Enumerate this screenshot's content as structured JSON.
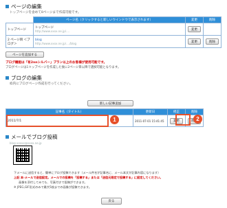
{
  "page_edit": {
    "title": "ページの編集",
    "subtitle": "トップページを含めて8ページまで作成可能です。",
    "header": "ページ名（クリックすると新しいウインドウで表示されます）",
    "edit_header": "変更",
    "delete_header": "削除",
    "rows": [
      {
        "label": "トップページ",
        "name": "トップページ",
        "url": "http://www.xxxx.ne.jp/....",
        "edit": "変更",
        "delete": ""
      },
      {
        "label": "2 ページ目 ＜ブログ＞",
        "name": "blog",
        "url": "http://www.xxxx.ne.jp/..../blog",
        "edit": "変更",
        "delete": "削除"
      }
    ],
    "add_button": "ページを追加する"
  },
  "notice": {
    "line1": "ブログ機能は「有2nnシルバー」プラン以上のお客様が使用可能です。",
    "line2": "ブログページは1トップページを作成した後に2ページ目以降で選択可能となります。"
  },
  "blog_edit": {
    "title": "ブログの編集",
    "subtitle": "枠内にブログページ作成を行ってください。",
    "new_button": "新しい記事追加",
    "headers": {
      "title": "記事名（タイトル）",
      "date": "更新日",
      "edit": "修正",
      "delete": "削除"
    },
    "rows": [
      {
        "title": "2011/7/1",
        "date": "2011-07-01 15:41:45",
        "edit": "変更",
        "delete": "削除"
      }
    ]
  },
  "callouts": {
    "one": "1",
    "two": "2"
  },
  "mail_blog": {
    "title": "メールでブログ投稿",
    "address": "blog-xxxxx@xxxx.ne.jp",
    "desc1": "下メールに送信すると、簡単にブログ投稿できます（メール件名が記事名に、メール本文が記事内容になります）",
    "desc2": "上記 本-メールで送信設定。メールでの投稿を「投稿する」または「送信元限定で投稿する」に設定してください。",
    "desc3": "画像を添付してみても、写真付きで投稿ができます。",
    "desc4": "※ JPEG,GIF形式のみで最大5枚までの画像が投稿できます。"
  },
  "back_button": "戻る"
}
